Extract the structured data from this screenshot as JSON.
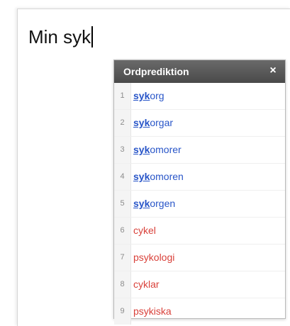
{
  "editor": {
    "text": "Min syk"
  },
  "popup": {
    "title": "Ordprediktion",
    "close_glyph": "×",
    "items": [
      {
        "num": "1",
        "prefix": "syk",
        "rest": "org",
        "kind": "match"
      },
      {
        "num": "2",
        "prefix": "syk",
        "rest": "orgar",
        "kind": "match"
      },
      {
        "num": "3",
        "prefix": "syk",
        "rest": "omorer",
        "kind": "match"
      },
      {
        "num": "4",
        "prefix": "syk",
        "rest": "omoren",
        "kind": "match"
      },
      {
        "num": "5",
        "prefix": "syk",
        "rest": "orgen",
        "kind": "match"
      },
      {
        "num": "6",
        "prefix": "",
        "rest": "cykel",
        "kind": "other"
      },
      {
        "num": "7",
        "prefix": "",
        "rest": "psykologi",
        "kind": "other"
      },
      {
        "num": "8",
        "prefix": "",
        "rest": "cyklar",
        "kind": "other"
      },
      {
        "num": "9",
        "prefix": "",
        "rest": "psykiska",
        "kind": "other"
      }
    ]
  },
  "colors": {
    "match_text": "#2855c8",
    "other_text": "#d9413a",
    "header_bg": "#555555"
  }
}
